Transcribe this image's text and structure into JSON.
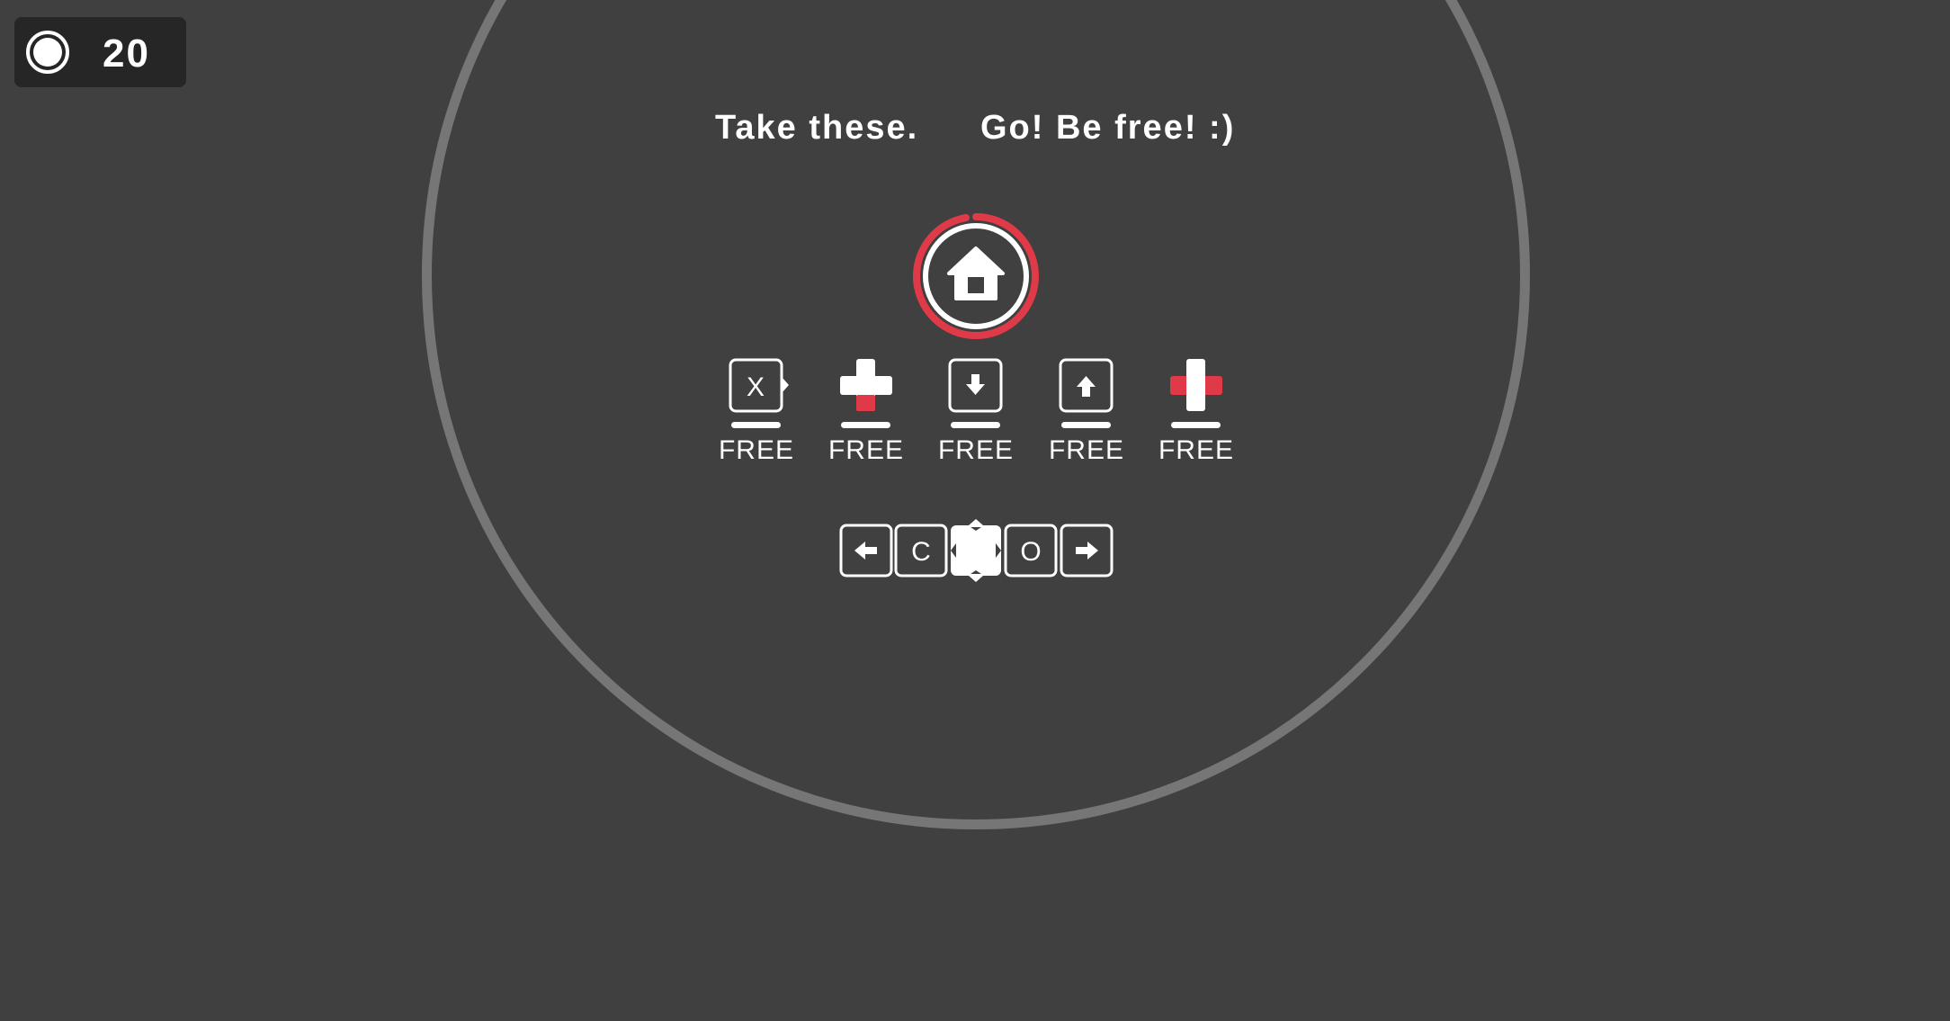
{
  "hud": {
    "counter_icon": "target-icon",
    "counter_value": "20"
  },
  "dialog": {
    "line1": "Take these.",
    "line2": "Go! Be free! :)"
  },
  "home": {
    "icon": "home-icon",
    "ring_color": "#e03a48"
  },
  "tools": [
    {
      "icon": "x-key-icon",
      "glyph": "X",
      "label": "FREE"
    },
    {
      "icon": "plus-red-bottom-icon",
      "label": "FREE"
    },
    {
      "icon": "down-arrow-key-icon",
      "label": "FREE"
    },
    {
      "icon": "up-arrow-key-icon",
      "label": "FREE"
    },
    {
      "icon": "plus-red-sides-icon",
      "label": "FREE"
    }
  ],
  "controls": [
    {
      "icon": "left-arrow-key-icon"
    },
    {
      "icon": "c-key-icon",
      "glyph": "C"
    },
    {
      "icon": "player-block-icon"
    },
    {
      "icon": "o-key-icon",
      "glyph": "O"
    },
    {
      "icon": "right-arrow-key-icon"
    }
  ],
  "colors": {
    "background": "#404040",
    "ring": "#767676",
    "accent": "#e03a48",
    "white": "#ffffff"
  }
}
